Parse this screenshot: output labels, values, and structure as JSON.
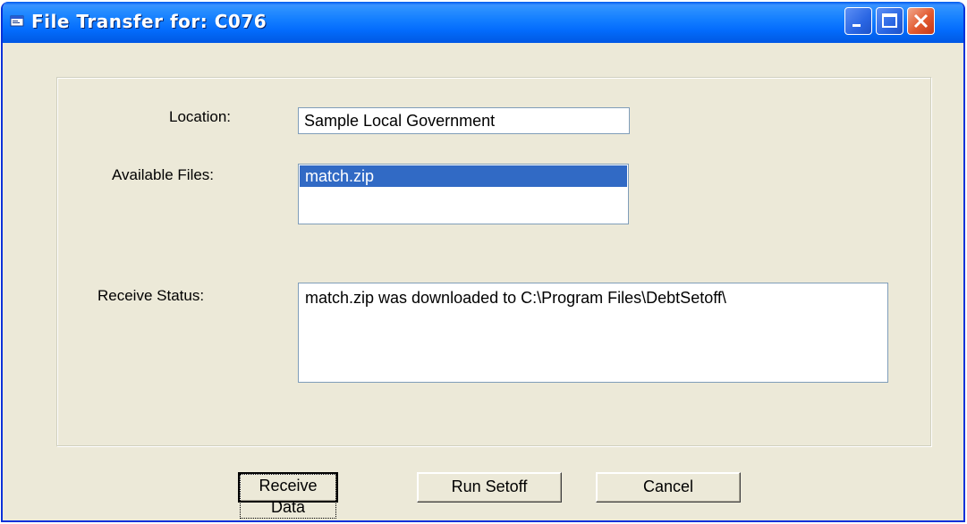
{
  "window": {
    "title": "File Transfer for: C076"
  },
  "form": {
    "location_label": "Location:",
    "location_value": "Sample Local Government",
    "files_label": "Available Files:",
    "files": [
      "match.zip"
    ],
    "selected_file": "match.zip",
    "status_label": "Receive Status:",
    "status_text": "match.zip was downloaded to C:\\Program Files\\DebtSetoff\\"
  },
  "buttons": {
    "receive": "Receive Data",
    "run_setoff": "Run Setoff",
    "cancel": "Cancel"
  },
  "icons": {
    "window": "app-window-icon",
    "minimize": "minimize-icon",
    "maximize": "maximize-icon",
    "close": "close-icon"
  },
  "colors": {
    "titlebar": "#0a5fe8",
    "selection": "#316ac5",
    "close_button": "#e25a2f"
  }
}
